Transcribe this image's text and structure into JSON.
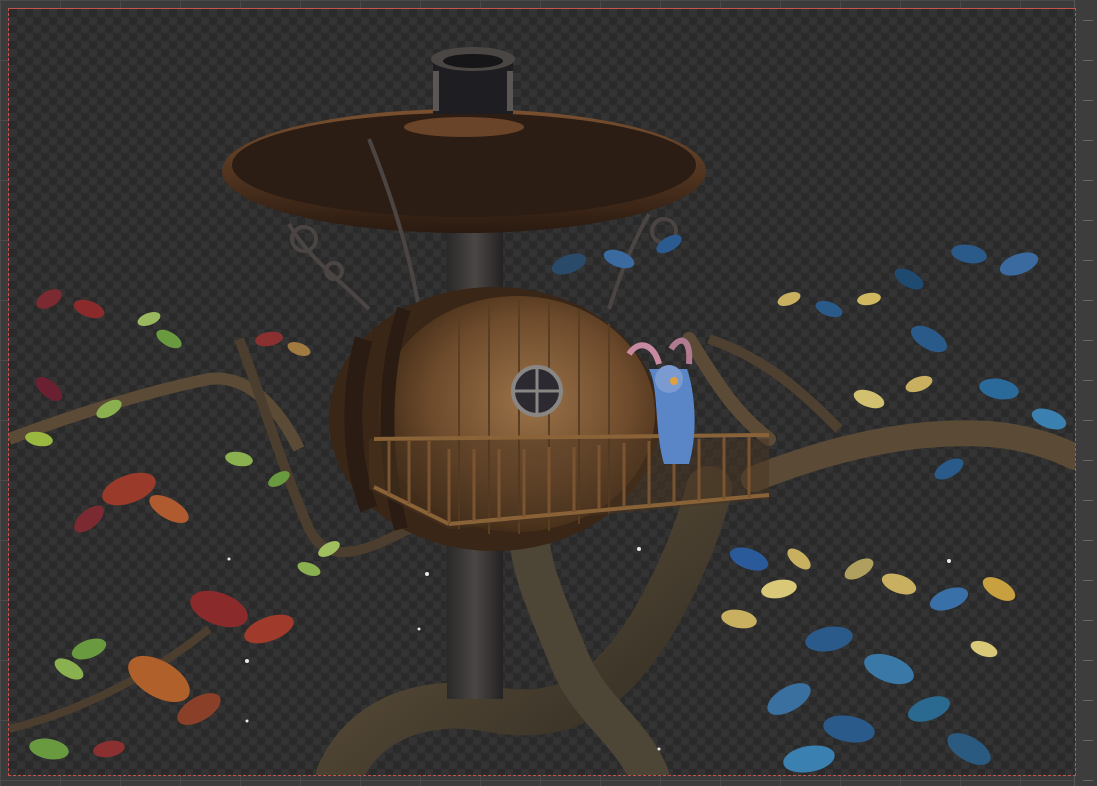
{
  "viewport": {
    "mode": "rendered-view",
    "colors": {
      "frame_border": "#c8524c",
      "checker_dark": "#2a2a2a",
      "checker_light": "#333333",
      "outer_background": "#3b3b3b"
    }
  },
  "scene": {
    "objects": [
      "treehouse-roof",
      "chimney",
      "barrel-house",
      "round-window",
      "balcony-railing",
      "rabbit-character",
      "support-trunk",
      "twisted-branches",
      "red-foliage",
      "blue-foliage",
      "wrought-iron-brackets"
    ]
  }
}
